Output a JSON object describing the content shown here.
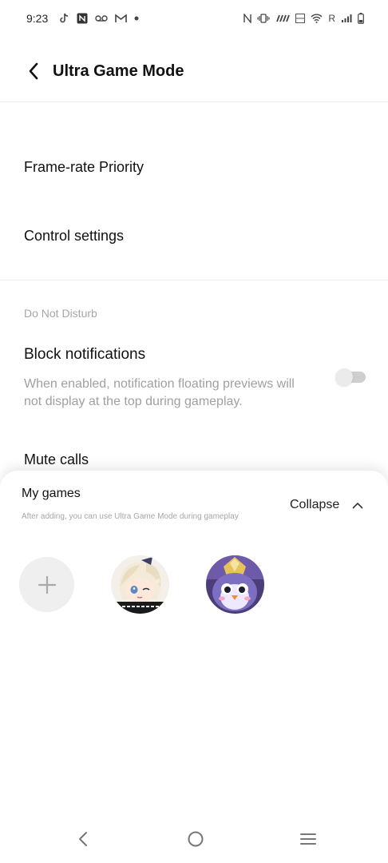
{
  "status_bar": {
    "time": "9:23",
    "carrier_text": "R",
    "left_icons": [
      "tiktok-icon",
      "nfc-icon",
      "voicemail-icon",
      "gmail-icon",
      "dot-icon"
    ],
    "right_icons": [
      "nfc-icon",
      "vibrate-icon",
      "hd-icon",
      "volte-icon",
      "wifi-icon",
      "signal-icon",
      "battery-icon"
    ]
  },
  "header": {
    "title": "Ultra Game Mode"
  },
  "menu": {
    "frame_rate": "Frame-rate Priority",
    "control_settings": "Control settings"
  },
  "dnd": {
    "section_label": "Do Not Disturb",
    "block_notifications": {
      "title": "Block notifications",
      "description": "When enabled, notification floating previews will not display at the top during gameplay.",
      "enabled": false
    },
    "mute_calls": "Mute calls"
  },
  "sheet": {
    "title": "My games",
    "subtitle": "After adding, you can use Ultra Game Mode during gameplay",
    "collapse_label": "Collapse",
    "games": [
      "genshin-impact-icon",
      "auto-chess-icon"
    ]
  },
  "colors": {
    "text_primary": "#111111",
    "text_secondary": "#a0a0a0",
    "toggle_off": "#cfcfcf",
    "sheet_bg": "#ffffff"
  }
}
